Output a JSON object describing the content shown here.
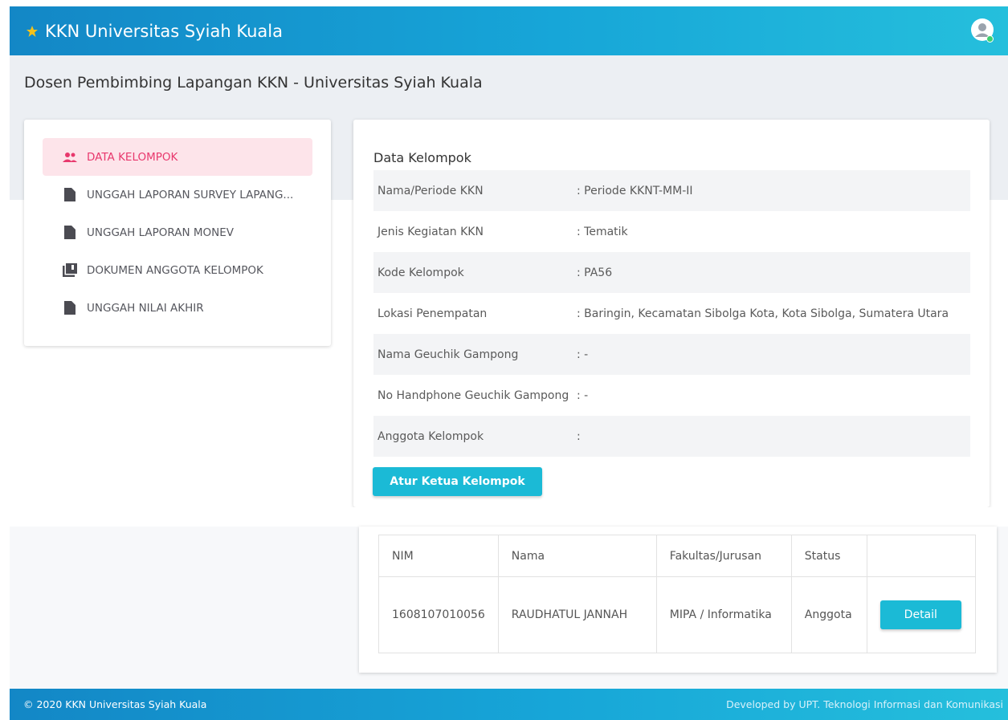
{
  "navbar": {
    "brand": "KKN Universitas Syiah Kuala",
    "logo_icon": "star-badge-icon",
    "avatar_icon": "user-circle-icon"
  },
  "page": {
    "heading": "Dosen Pembimbing Lapangan KKN - Universitas Syiah Kuala"
  },
  "sidebar": {
    "items": [
      {
        "label": "DATA KELOMPOK",
        "icon": "group-icon",
        "active": true
      },
      {
        "label": "UNGGAH LAPORAN SURVEY LAPANG...",
        "icon": "file-icon",
        "active": false
      },
      {
        "label": "UNGGAH LAPORAN MONEV",
        "icon": "file-icon",
        "active": false
      },
      {
        "label": "DOKUMEN ANGGOTA KELOMPOK",
        "icon": "library-icon",
        "active": false
      },
      {
        "label": "UNGGAH NILAI AKHIR",
        "icon": "file-icon",
        "active": false
      }
    ]
  },
  "main": {
    "title": "Data Kelompok",
    "rows": [
      {
        "label": "Nama/Periode KKN",
        "value": ": Periode KKNT-MM-II"
      },
      {
        "label": "Jenis Kegiatan KKN",
        "value": ": Tematik"
      },
      {
        "label": "Kode Kelompok",
        "value": ": PA56"
      },
      {
        "label": "Lokasi Penempatan",
        "value": ": Baringin, Kecamatan Sibolga Kota, Kota Sibolga, Sumatera Utara"
      },
      {
        "label": "Nama Geuchik Gampong",
        "value": ": -"
      },
      {
        "label": "No Handphone Geuchik Gampong",
        "value": ": -"
      },
      {
        "label": "Anggota Kelompok",
        "value": ":"
      }
    ],
    "button_label": "Atur Ketua Kelompok"
  },
  "members": {
    "headers": [
      "NIM",
      "Nama",
      "Fakultas/Jurusan",
      "Status",
      ""
    ],
    "rows": [
      {
        "nim": "1608107010056",
        "nama": "RAUDHATUL JANNAH",
        "fakultas": "MIPA / Informatika",
        "status": "Anggota",
        "action": "Detail"
      }
    ]
  },
  "footer": {
    "left": "© 2020 KKN Universitas Syiah Kuala",
    "right": "Developed by UPT. Teknologi Informasi dan Komunikasi"
  },
  "colors": {
    "navbar": "#17a6d8",
    "accent_button": "#1bbad6",
    "active_menu_bg": "#fde4ea",
    "active_menu_text": "#e8386d"
  }
}
